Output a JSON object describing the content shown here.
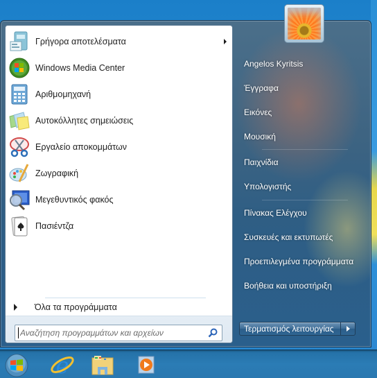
{
  "start_menu": {
    "pinned_programs": [
      {
        "label": "Γρήγορα αποτελέσματα",
        "icon": "getting-started-icon",
        "has_submenu": true
      },
      {
        "label": "Windows Media Center",
        "icon": "windows-media-center-icon",
        "has_submenu": false
      },
      {
        "label": "Αριθμομηχανή",
        "icon": "calculator-icon",
        "has_submenu": false
      },
      {
        "label": "Αυτοκόλλητες σημειώσεις",
        "icon": "sticky-notes-icon",
        "has_submenu": false
      },
      {
        "label": "Εργαλείο αποκομμάτων",
        "icon": "snipping-tool-icon",
        "has_submenu": false
      },
      {
        "label": "Ζωγραφική",
        "icon": "paint-icon",
        "has_submenu": false
      },
      {
        "label": "Μεγεθυντικός φακός",
        "icon": "magnifier-icon",
        "has_submenu": false
      },
      {
        "label": "Πασιέντζα",
        "icon": "solitaire-icon",
        "has_submenu": false
      }
    ],
    "all_programs_label": "Όλα τα προγράμματα",
    "search": {
      "placeholder": "Αναζήτηση προγραμμάτων και αρχείων",
      "value": ""
    },
    "user": {
      "name": "Angelos Kyritsis",
      "picture": "flower-user-picture"
    },
    "right_items": [
      {
        "label": "Angelos Kyritsis",
        "group": 1
      },
      {
        "label": "Έγγραφα",
        "group": 1
      },
      {
        "label": "Εικόνες",
        "group": 1
      },
      {
        "label": "Μουσική",
        "group": 1
      },
      {
        "label": "Παιχνίδια",
        "group": 2
      },
      {
        "label": "Υπολογιστής",
        "group": 2
      },
      {
        "label": "Πίνακας Ελέγχου",
        "group": 3
      },
      {
        "label": "Συσκευές και εκτυπωτές",
        "group": 3
      },
      {
        "label": "Προεπιλεγμένα προγράμματα",
        "group": 3
      },
      {
        "label": "Βοήθεια και υποστήριξη",
        "group": 3
      }
    ],
    "shutdown_label": "Τερματισμός λειτουργίας"
  },
  "taskbar": {
    "items": [
      {
        "name": "start-orb",
        "icon": "windows-logo-icon"
      },
      {
        "name": "internet-explorer",
        "icon": "internet-explorer-icon"
      },
      {
        "name": "windows-explorer",
        "icon": "folder-icon"
      },
      {
        "name": "windows-media-player",
        "icon": "media-player-icon"
      }
    ]
  }
}
